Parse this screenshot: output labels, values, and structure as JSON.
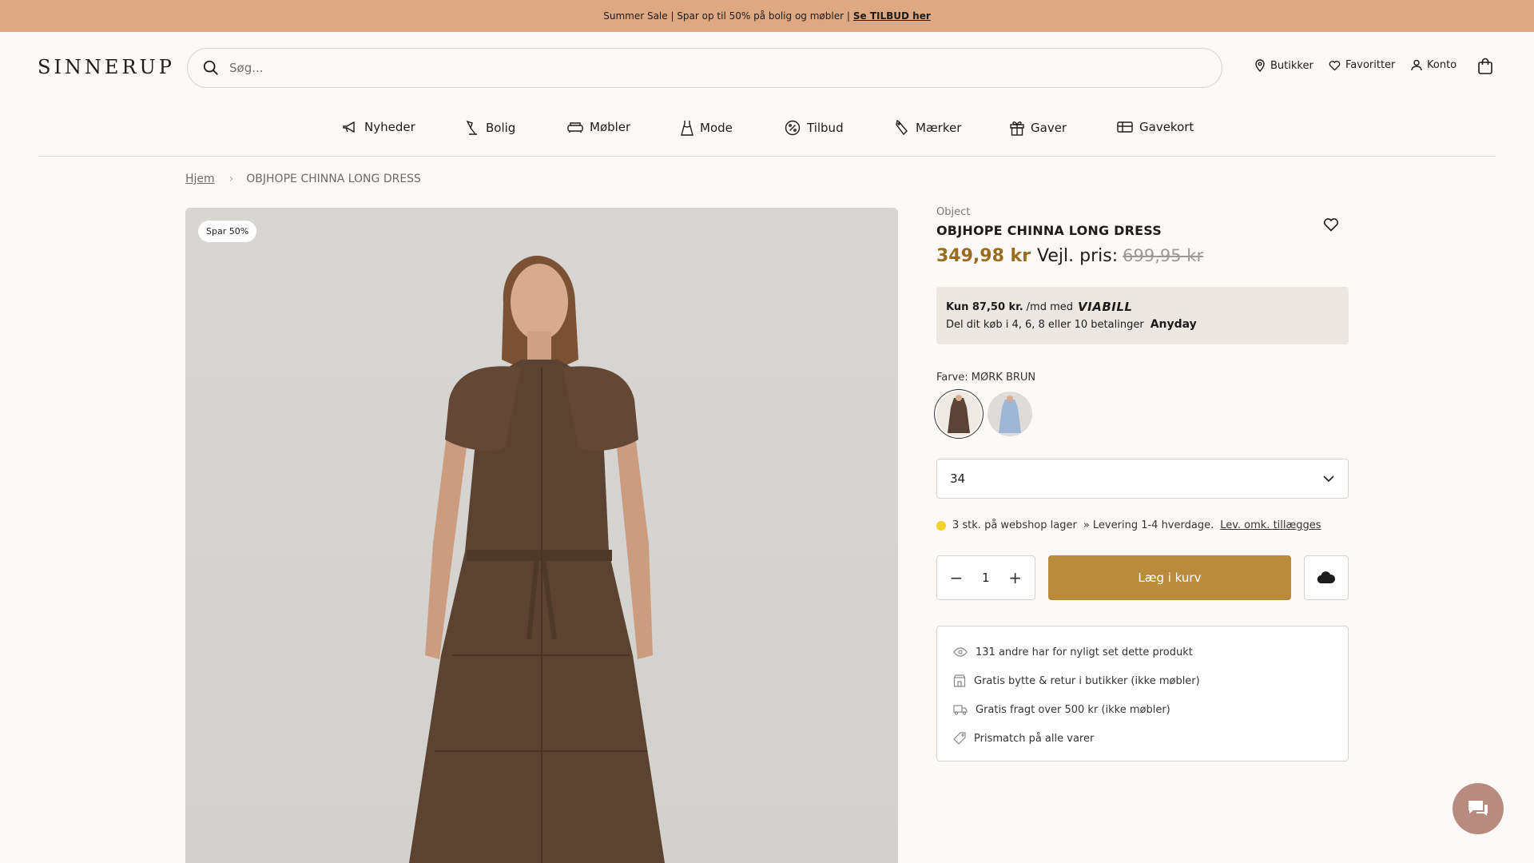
{
  "promo": {
    "text": "Summer Sale | Spar op til 50% på bolig og møbler |",
    "link": "Se TILBUD her"
  },
  "header": {
    "logo": "SINNERUP",
    "search_placeholder": "Søg...",
    "stores": "Butikker",
    "favorites": "Favoritter",
    "account": "Konto"
  },
  "nav": [
    "Nyheder",
    "Bolig",
    "Møbler",
    "Mode",
    "Tilbud",
    "Mærker",
    "Gaver",
    "Gavekort"
  ],
  "breadcrumb": {
    "home": "Hjem",
    "current": "OBJHOPE CHINNA LONG DRESS"
  },
  "product": {
    "badge": "Spar 50%",
    "brand": "Object",
    "title": "OBJHOPE CHINNA LONG DRESS",
    "price_now": "349,98 kr",
    "price_label": "Vejl. pris:",
    "price_old": "699,95 kr",
    "finance_line1": "Kun 87,50 kr.",
    "finance_line1_suffix": "/md med",
    "finance_logo1": "VIABILL",
    "finance_line2": "Del dit køb i 4, 6, 8 eller 10 betalinger",
    "finance_logo2": "Anyday",
    "color_label": "Farve: MØRK BRUN",
    "colors": [
      {
        "name": "MØRK BRUN",
        "hex": "#5a4334"
      },
      {
        "name": "BLÅ",
        "hex": "#9db7d5"
      }
    ],
    "size": "34",
    "stock": "3 stk. på webshop lager",
    "delivery": "» Levering 1-4 hverdage.",
    "delivery_link": "Lev. omk. tillægges",
    "quantity": "1",
    "add_to_cart": "Læg i kurv",
    "usps": [
      "131 andre har for nyligt set dette produkt",
      "Gratis bytte & retur i butikker (ikke møbler)",
      "Gratis fragt over 500 kr (ikke møbler)",
      "Prismatch på alle varer"
    ]
  },
  "colors": {
    "promo_bg": "#dea883",
    "accent": "#b98c3c",
    "price": "#9a6c20",
    "chat": "#b78c7e"
  }
}
